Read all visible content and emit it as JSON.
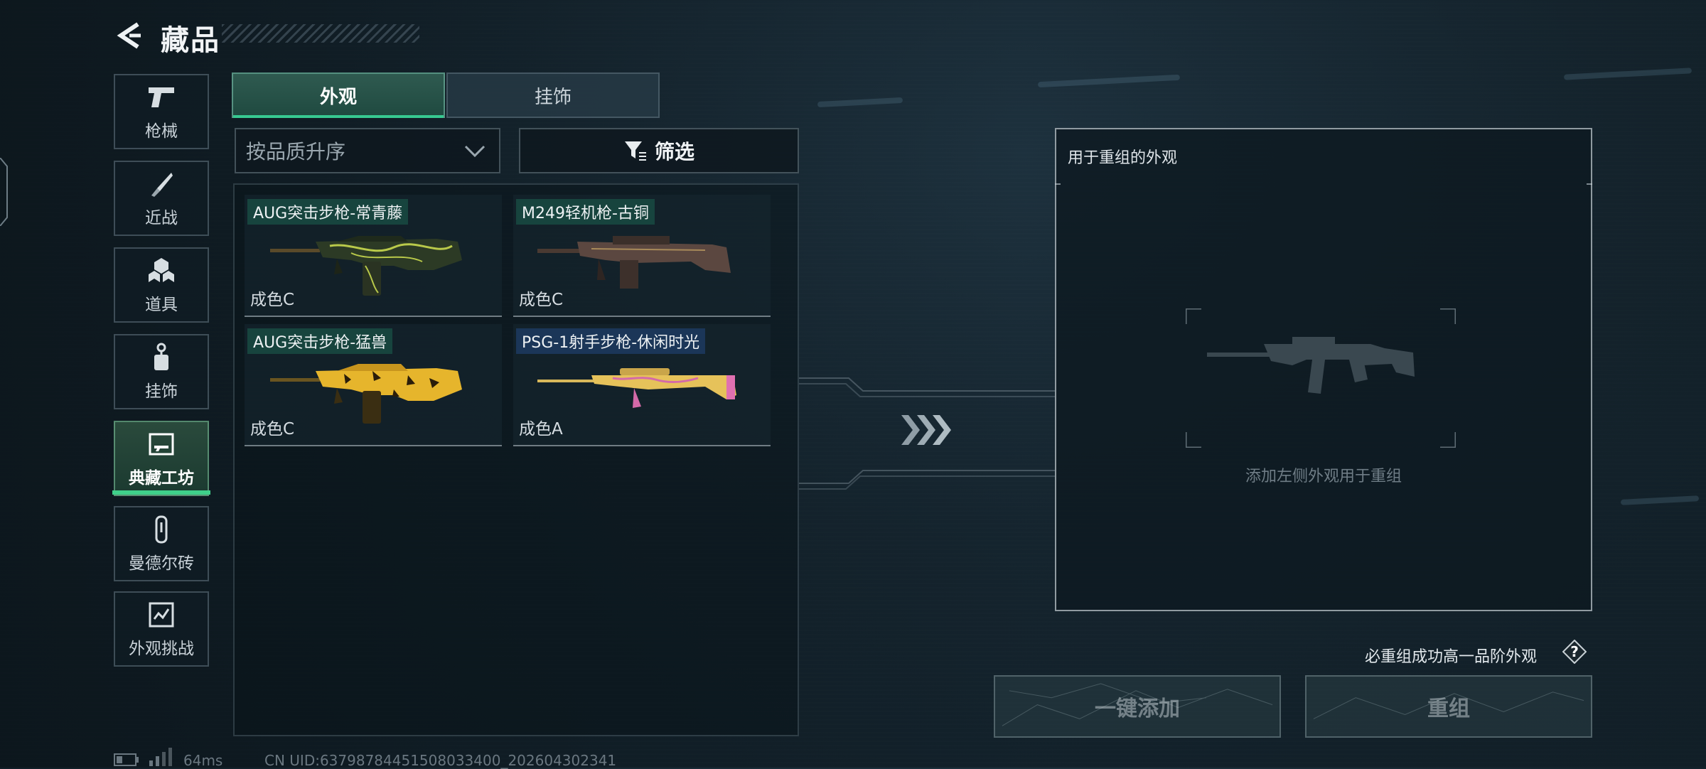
{
  "header": {
    "title": "藏品"
  },
  "nav": {
    "items": [
      {
        "key": "guns",
        "label": "枪械",
        "icon": "pistol-icon"
      },
      {
        "key": "melee",
        "label": "近战",
        "icon": "knife-icon"
      },
      {
        "key": "props",
        "label": "道具",
        "icon": "cubes-icon"
      },
      {
        "key": "charms",
        "label": "挂饰",
        "icon": "charm-icon"
      },
      {
        "key": "workshop",
        "label": "典藏工坊",
        "icon": "workshop-icon",
        "active": true
      },
      {
        "key": "mandel",
        "label": "曼德尔砖",
        "icon": "brick-icon"
      },
      {
        "key": "challenge",
        "label": "外观挑战",
        "icon": "challenge-icon"
      }
    ]
  },
  "tabs": [
    {
      "label": "外观",
      "active": true
    },
    {
      "label": "挂饰",
      "active": false
    }
  ],
  "sort": {
    "value": "按品质升序"
  },
  "filter": {
    "label": "筛选"
  },
  "skins": [
    {
      "name": "AUG突击步枪-常青藤",
      "grade": "成色C",
      "tag": "green"
    },
    {
      "name": "M249轻机枪-古铜",
      "grade": "成色C",
      "tag": "green"
    },
    {
      "name": "AUG突击步枪-猛兽",
      "grade": "成色C",
      "tag": "green"
    },
    {
      "name": "PSG-1射手步枪-休闲时光",
      "grade": "成色A",
      "tag": "blue"
    }
  ],
  "reforge": {
    "title": "用于重组的外观",
    "hint": "添加左侧外观用于重组",
    "rule": "必重组成功高一品阶外观",
    "add_all_label": "一键添加",
    "reforge_label": "重组"
  },
  "status": {
    "ping": "64ms",
    "uid": "CN UID:6379878445150803340​0_202604302341"
  },
  "colors": {
    "accent": "#37c991",
    "background": "#15242e"
  }
}
